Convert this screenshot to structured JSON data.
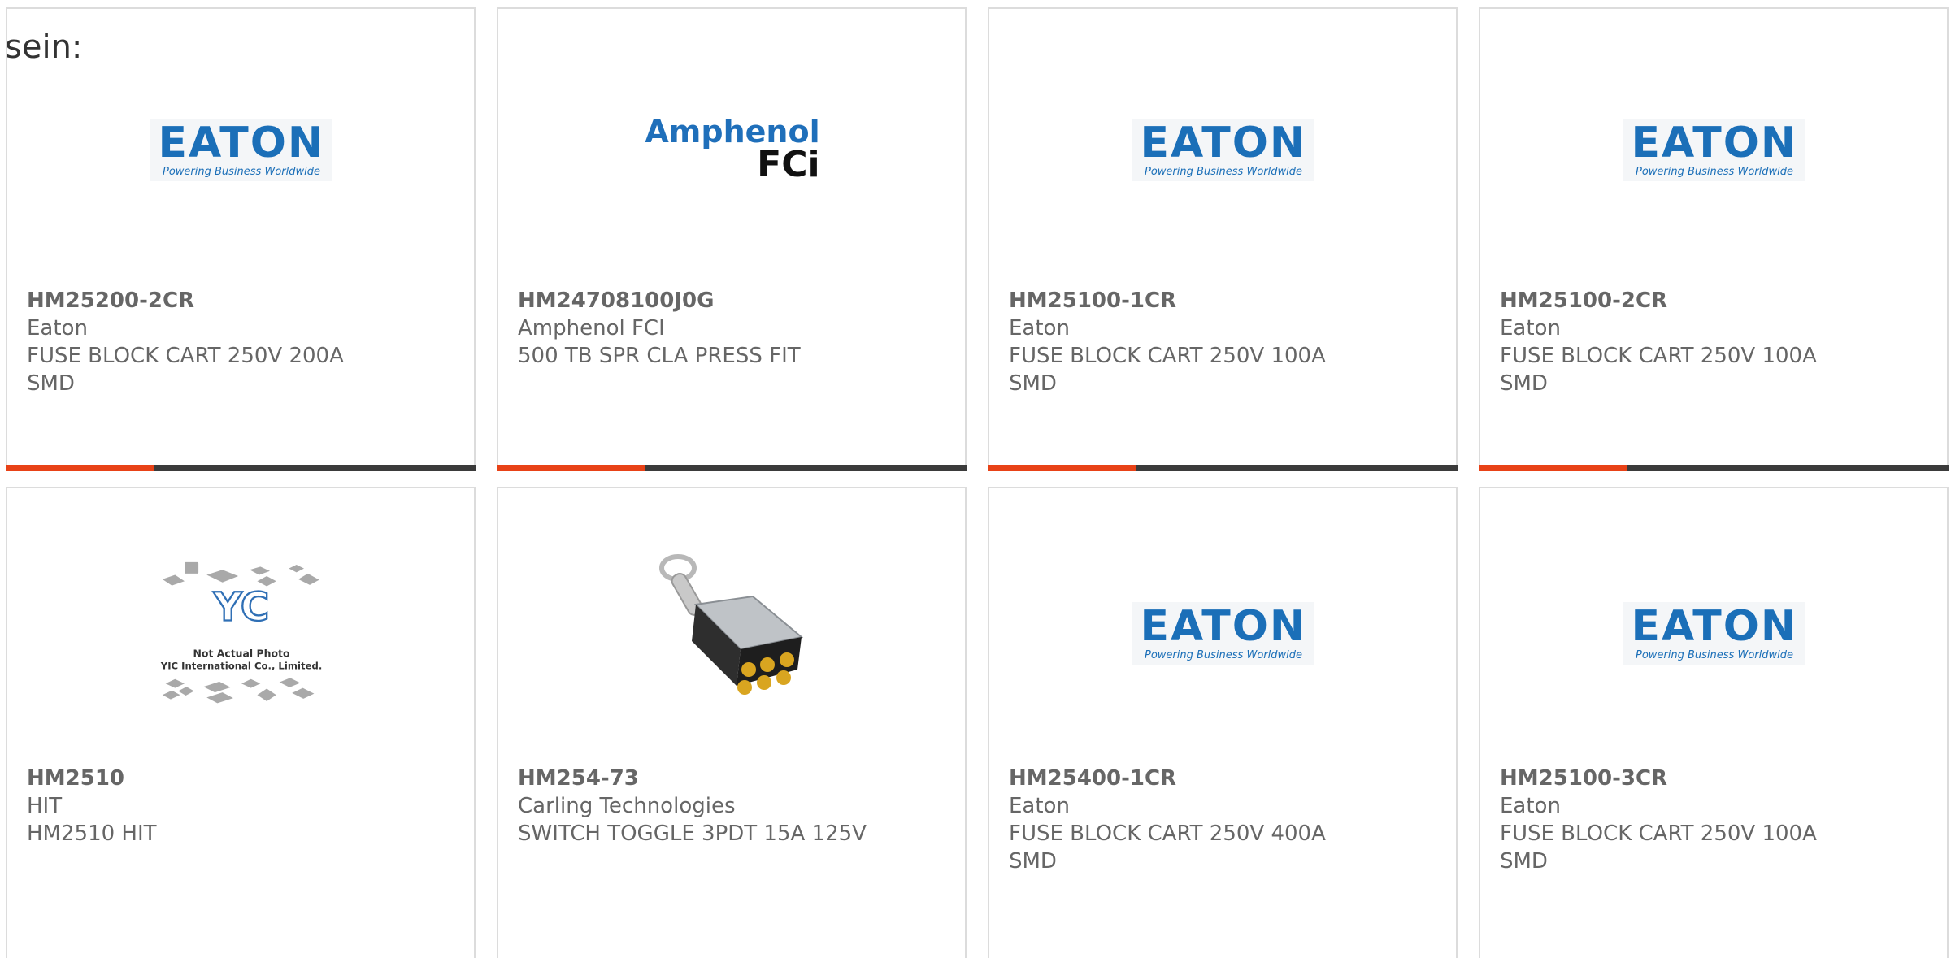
{
  "heading": "sein:",
  "products": [
    {
      "part": "HM25200-2CR",
      "maker": "Eaton",
      "desc1": "FUSE BLOCK CART 250V 200A",
      "desc2": "SMD",
      "logo": "eaton-logo"
    },
    {
      "part": "HM24708100J0G",
      "maker": "Amphenol FCI",
      "desc1": "500 TB SPR CLA PRESS FIT",
      "desc2": "",
      "logo": "amphenol-fci-logo"
    },
    {
      "part": "HM25100-1CR",
      "maker": "Eaton",
      "desc1": "FUSE BLOCK CART 250V 100A",
      "desc2": "SMD",
      "logo": "eaton-logo"
    },
    {
      "part": "HM25100-2CR",
      "maker": "Eaton",
      "desc1": "FUSE BLOCK CART 250V 100A",
      "desc2": "SMD",
      "logo": "eaton-logo"
    },
    {
      "part": "HM2510",
      "maker": "HIT",
      "desc1": "HM2510 HIT",
      "desc2": "",
      "logo": "placeholder-photo",
      "placeholder_line1": "Not Actual Photo",
      "placeholder_line2": "YIC International Co., Limited."
    },
    {
      "part": "HM254-73",
      "maker": "Carling Technologies",
      "desc1": "SWITCH TOGGLE 3PDT 15A 125V",
      "desc2": "",
      "logo": "toggle-switch-photo"
    },
    {
      "part": "HM25400-1CR",
      "maker": "Eaton",
      "desc1": "FUSE BLOCK CART 250V 400A",
      "desc2": "SMD",
      "logo": "eaton-logo"
    },
    {
      "part": "HM25100-3CR",
      "maker": "Eaton",
      "desc1": "FUSE BLOCK CART 250V 100A",
      "desc2": "SMD",
      "logo": "eaton-logo"
    }
  ],
  "logos": {
    "eaton_word": "EATON",
    "eaton_tag": "Powering Business Worldwide",
    "amphenol_top": "Amphenol",
    "amphenol_bottom": "FCi"
  },
  "colors": {
    "accent": "#e84217",
    "bar": "#3b3b3b",
    "eaton_blue": "#1b6fb8",
    "text": "#666666"
  }
}
